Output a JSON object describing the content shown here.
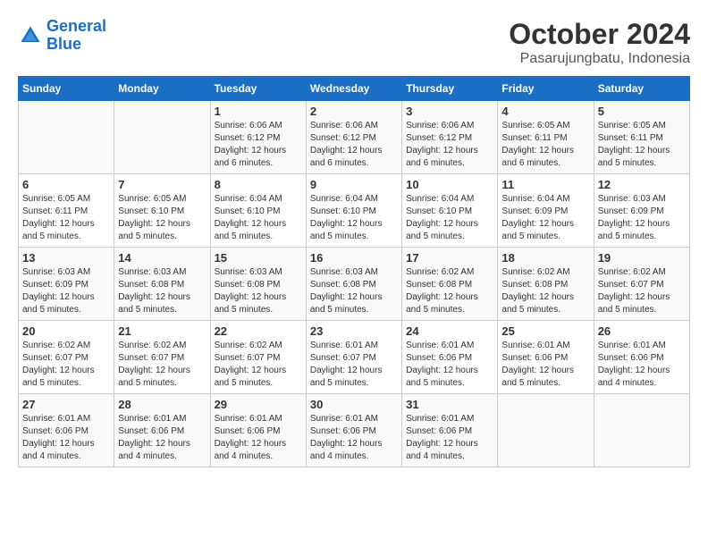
{
  "logo": {
    "line1": "General",
    "line2": "Blue"
  },
  "title": "October 2024",
  "subtitle": "Pasarujungbatu, Indonesia",
  "days_of_week": [
    "Sunday",
    "Monday",
    "Tuesday",
    "Wednesday",
    "Thursday",
    "Friday",
    "Saturday"
  ],
  "weeks": [
    [
      {
        "day": "",
        "info": ""
      },
      {
        "day": "",
        "info": ""
      },
      {
        "day": "1",
        "info": "Sunrise: 6:06 AM\nSunset: 6:12 PM\nDaylight: 12 hours and 6 minutes."
      },
      {
        "day": "2",
        "info": "Sunrise: 6:06 AM\nSunset: 6:12 PM\nDaylight: 12 hours and 6 minutes."
      },
      {
        "day": "3",
        "info": "Sunrise: 6:06 AM\nSunset: 6:12 PM\nDaylight: 12 hours and 6 minutes."
      },
      {
        "day": "4",
        "info": "Sunrise: 6:05 AM\nSunset: 6:11 PM\nDaylight: 12 hours and 6 minutes."
      },
      {
        "day": "5",
        "info": "Sunrise: 6:05 AM\nSunset: 6:11 PM\nDaylight: 12 hours and 5 minutes."
      }
    ],
    [
      {
        "day": "6",
        "info": "Sunrise: 6:05 AM\nSunset: 6:11 PM\nDaylight: 12 hours and 5 minutes."
      },
      {
        "day": "7",
        "info": "Sunrise: 6:05 AM\nSunset: 6:10 PM\nDaylight: 12 hours and 5 minutes."
      },
      {
        "day": "8",
        "info": "Sunrise: 6:04 AM\nSunset: 6:10 PM\nDaylight: 12 hours and 5 minutes."
      },
      {
        "day": "9",
        "info": "Sunrise: 6:04 AM\nSunset: 6:10 PM\nDaylight: 12 hours and 5 minutes."
      },
      {
        "day": "10",
        "info": "Sunrise: 6:04 AM\nSunset: 6:10 PM\nDaylight: 12 hours and 5 minutes."
      },
      {
        "day": "11",
        "info": "Sunrise: 6:04 AM\nSunset: 6:09 PM\nDaylight: 12 hours and 5 minutes."
      },
      {
        "day": "12",
        "info": "Sunrise: 6:03 AM\nSunset: 6:09 PM\nDaylight: 12 hours and 5 minutes."
      }
    ],
    [
      {
        "day": "13",
        "info": "Sunrise: 6:03 AM\nSunset: 6:09 PM\nDaylight: 12 hours and 5 minutes."
      },
      {
        "day": "14",
        "info": "Sunrise: 6:03 AM\nSunset: 6:08 PM\nDaylight: 12 hours and 5 minutes."
      },
      {
        "day": "15",
        "info": "Sunrise: 6:03 AM\nSunset: 6:08 PM\nDaylight: 12 hours and 5 minutes."
      },
      {
        "day": "16",
        "info": "Sunrise: 6:03 AM\nSunset: 6:08 PM\nDaylight: 12 hours and 5 minutes."
      },
      {
        "day": "17",
        "info": "Sunrise: 6:02 AM\nSunset: 6:08 PM\nDaylight: 12 hours and 5 minutes."
      },
      {
        "day": "18",
        "info": "Sunrise: 6:02 AM\nSunset: 6:08 PM\nDaylight: 12 hours and 5 minutes."
      },
      {
        "day": "19",
        "info": "Sunrise: 6:02 AM\nSunset: 6:07 PM\nDaylight: 12 hours and 5 minutes."
      }
    ],
    [
      {
        "day": "20",
        "info": "Sunrise: 6:02 AM\nSunset: 6:07 PM\nDaylight: 12 hours and 5 minutes."
      },
      {
        "day": "21",
        "info": "Sunrise: 6:02 AM\nSunset: 6:07 PM\nDaylight: 12 hours and 5 minutes."
      },
      {
        "day": "22",
        "info": "Sunrise: 6:02 AM\nSunset: 6:07 PM\nDaylight: 12 hours and 5 minutes."
      },
      {
        "day": "23",
        "info": "Sunrise: 6:01 AM\nSunset: 6:07 PM\nDaylight: 12 hours and 5 minutes."
      },
      {
        "day": "24",
        "info": "Sunrise: 6:01 AM\nSunset: 6:06 PM\nDaylight: 12 hours and 5 minutes."
      },
      {
        "day": "25",
        "info": "Sunrise: 6:01 AM\nSunset: 6:06 PM\nDaylight: 12 hours and 5 minutes."
      },
      {
        "day": "26",
        "info": "Sunrise: 6:01 AM\nSunset: 6:06 PM\nDaylight: 12 hours and 4 minutes."
      }
    ],
    [
      {
        "day": "27",
        "info": "Sunrise: 6:01 AM\nSunset: 6:06 PM\nDaylight: 12 hours and 4 minutes."
      },
      {
        "day": "28",
        "info": "Sunrise: 6:01 AM\nSunset: 6:06 PM\nDaylight: 12 hours and 4 minutes."
      },
      {
        "day": "29",
        "info": "Sunrise: 6:01 AM\nSunset: 6:06 PM\nDaylight: 12 hours and 4 minutes."
      },
      {
        "day": "30",
        "info": "Sunrise: 6:01 AM\nSunset: 6:06 PM\nDaylight: 12 hours and 4 minutes."
      },
      {
        "day": "31",
        "info": "Sunrise: 6:01 AM\nSunset: 6:06 PM\nDaylight: 12 hours and 4 minutes."
      },
      {
        "day": "",
        "info": ""
      },
      {
        "day": "",
        "info": ""
      }
    ]
  ]
}
